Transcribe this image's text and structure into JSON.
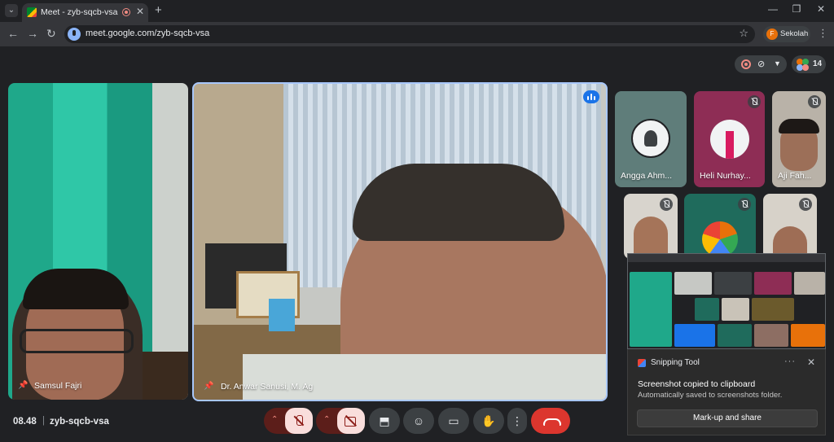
{
  "browser": {
    "tab_title": "Meet - zyb-sqcb-vsa",
    "tab_close": "✕",
    "new_tab": "+",
    "url": "meet.google.com/zyb-sqcb-vsa",
    "profile_initial": "F",
    "profile_name": "Sekolah",
    "window_controls": {
      "minimize": "—",
      "restore": "❐",
      "close": "✕"
    }
  },
  "meet": {
    "participant_count": "14",
    "tiles": {
      "left": {
        "name": "Samsul Fajri"
      },
      "main": {
        "name": "Dr. Anwar Sanusi, M. Ag"
      },
      "small": [
        {
          "name": "Angga Ahm..."
        },
        {
          "name": "Heli Nurhay..."
        },
        {
          "name": "Aji Fah..."
        }
      ]
    },
    "meeting_time": "08.48",
    "separator": "|",
    "meeting_code": "zyb-sqcb-vsa"
  },
  "toast": {
    "app_name": "Snipping Tool",
    "more": "···",
    "close": "✕",
    "title": "Screenshot copied to clipboard",
    "subtitle": "Automatically saved to screenshots folder.",
    "button_label": "Mark-up and share"
  },
  "colors": {
    "accent": "#1a73e8",
    "end_call": "#dc362e",
    "muted_bg": "#f9dedc",
    "background": "#202124"
  }
}
